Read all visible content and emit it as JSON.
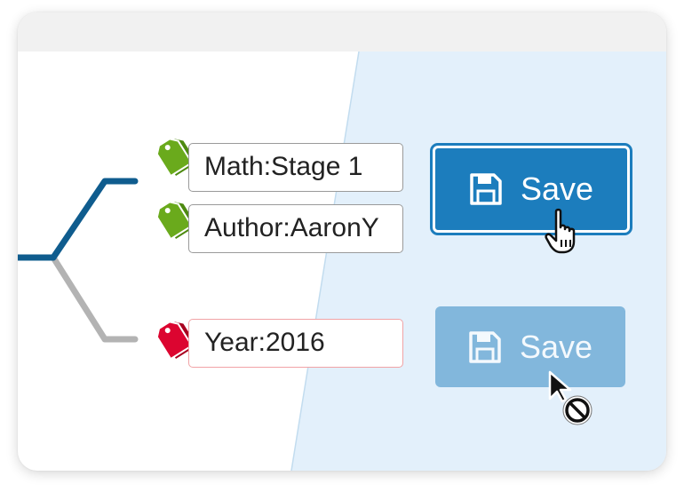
{
  "tags": [
    {
      "label": "Math:Stage 1",
      "icon": "tag-icon",
      "status": "valid",
      "color": "#5f9d17"
    },
    {
      "label": "Author:AaronY",
      "icon": "tag-icon",
      "status": "valid",
      "color": "#5f9d17"
    },
    {
      "label": "Year:2016",
      "icon": "tag-icon",
      "status": "invalid",
      "color": "#d9062e"
    }
  ],
  "buttons": {
    "save_active": {
      "label": "Save",
      "icon": "floppy-disk-icon",
      "color": "#1c7dbd"
    },
    "save_disabled": {
      "label": "Save",
      "icon": "floppy-disk-icon",
      "color": "#82b7dc"
    }
  },
  "cursors": {
    "active": "pointer-hand-icon",
    "disabled": "not-allowed-icon"
  },
  "colors": {
    "branch_active": "#0f5c8e",
    "branch_inactive": "#b3b3b3",
    "panel_background": "#e3f0fb"
  }
}
